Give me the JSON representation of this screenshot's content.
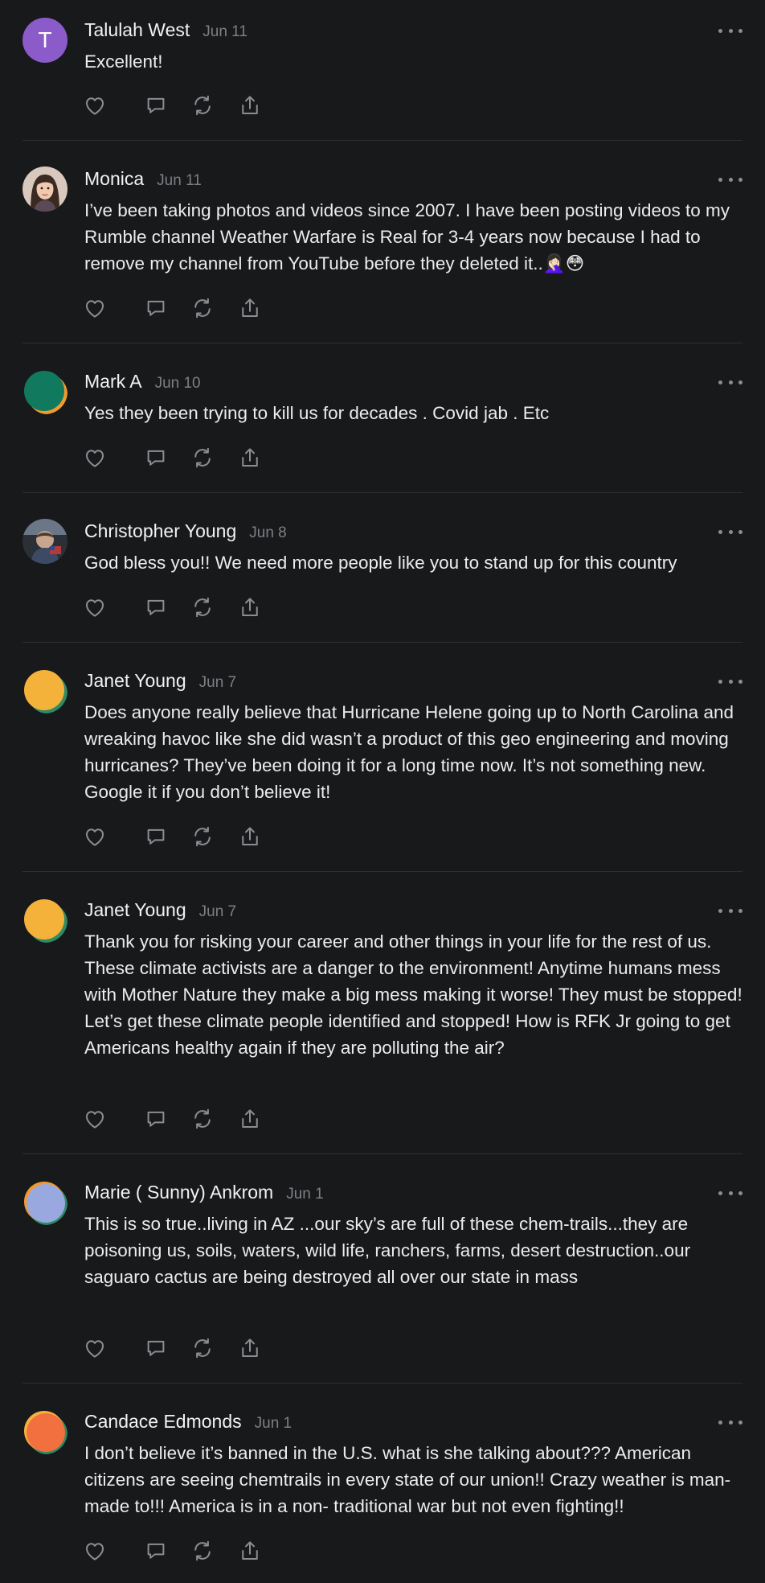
{
  "comments": [
    {
      "name": "Talulah West",
      "date": "Jun 11",
      "avatar_letter": "T",
      "text": "Excellent!"
    },
    {
      "name": "Monica",
      "date": "Jun 11",
      "text": "I’ve been taking photos and videos since 2007. I have been posting videos to my Rumble channel Weather Warfare is Real for 3-4 years now because I had to remove my channel from YouTube before they deleted it..🤦🏻‍♀️😳"
    },
    {
      "name": "Mark A",
      "date": "Jun 10",
      "text": "Yes they been trying to kill us for decades . Covid jab . Etc"
    },
    {
      "name": "Christopher Young",
      "date": "Jun 8",
      "text": "God bless you!! We need more people like you to stand up for this country"
    },
    {
      "name": "Janet Young",
      "date": "Jun 7",
      "text": "Does anyone really believe that Hurricane Helene going up to North Carolina and wreaking havoc like she did wasn’t a product of this geo engineering and moving hurricanes? They’ve been doing it for a long time now. It’s not something new. Google it if you don’t believe it!"
    },
    {
      "name": "Janet Young",
      "date": "Jun 7",
      "text": "Thank you for risking your career and other things in your life for the rest of us. These climate activists are a danger to the environment! Anytime humans mess with Mother Nature they make a big mess making it worse! They must be stopped! Let’s get these climate people identified and stopped! How is RFK Jr going to get Americans healthy again if they are polluting the air?"
    },
    {
      "name": "Marie ( Sunny) Ankrom",
      "date": "Jun 1",
      "text": "This is so true..living in AZ ...our sky’s are full of these chem-trails...they are poisoning us, soils, waters, wild life, ranchers, farms, desert destruction..our saguaro cactus are being destroyed all over our state in mass"
    },
    {
      "name": "Candace Edmonds",
      "date": "Jun 1",
      "text": "I don’t believe it’s banned in the U.S. what is she talking about??? American citizens are seeing chemtrails in every state of our union!! Crazy weather is man-made to!!! America is in a non- traditional war but not even fighting!!"
    }
  ],
  "action_icons": [
    "heart-icon",
    "comment-icon",
    "restack-icon",
    "share-icon"
  ],
  "colors": {
    "background": "#18191b",
    "text": "#ececec",
    "muted": "#7d7f84",
    "divider": "#2e2f33",
    "icon": "#8b8d92"
  }
}
